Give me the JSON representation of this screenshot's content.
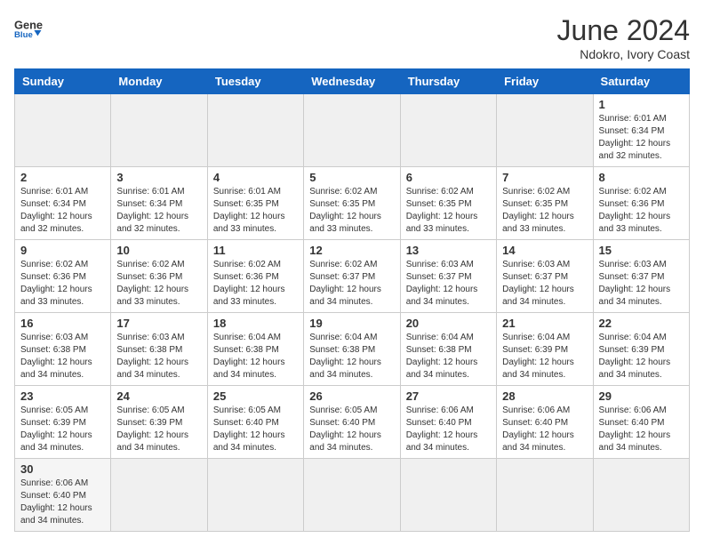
{
  "header": {
    "logo_general": "General",
    "logo_blue": "Blue",
    "month_title": "June 2024",
    "location": "Ndokro, Ivory Coast"
  },
  "weekdays": [
    "Sunday",
    "Monday",
    "Tuesday",
    "Wednesday",
    "Thursday",
    "Friday",
    "Saturday"
  ],
  "weeks": [
    [
      {
        "day": "",
        "empty": true
      },
      {
        "day": "",
        "empty": true
      },
      {
        "day": "",
        "empty": true
      },
      {
        "day": "",
        "empty": true
      },
      {
        "day": "",
        "empty": true
      },
      {
        "day": "",
        "empty": true
      },
      {
        "day": "1",
        "sunrise": "6:01 AM",
        "sunset": "6:34 PM",
        "daylight": "12 hours and 32 minutes."
      }
    ],
    [
      {
        "day": "2",
        "sunrise": "6:01 AM",
        "sunset": "6:34 PM",
        "daylight": "12 hours and 32 minutes."
      },
      {
        "day": "3",
        "sunrise": "6:01 AM",
        "sunset": "6:34 PM",
        "daylight": "12 hours and 32 minutes."
      },
      {
        "day": "4",
        "sunrise": "6:01 AM",
        "sunset": "6:35 PM",
        "daylight": "12 hours and 33 minutes."
      },
      {
        "day": "5",
        "sunrise": "6:02 AM",
        "sunset": "6:35 PM",
        "daylight": "12 hours and 33 minutes."
      },
      {
        "day": "6",
        "sunrise": "6:02 AM",
        "sunset": "6:35 PM",
        "daylight": "12 hours and 33 minutes."
      },
      {
        "day": "7",
        "sunrise": "6:02 AM",
        "sunset": "6:35 PM",
        "daylight": "12 hours and 33 minutes."
      },
      {
        "day": "8",
        "sunrise": "6:02 AM",
        "sunset": "6:36 PM",
        "daylight": "12 hours and 33 minutes."
      }
    ],
    [
      {
        "day": "9",
        "sunrise": "6:02 AM",
        "sunset": "6:36 PM",
        "daylight": "12 hours and 33 minutes."
      },
      {
        "day": "10",
        "sunrise": "6:02 AM",
        "sunset": "6:36 PM",
        "daylight": "12 hours and 33 minutes."
      },
      {
        "day": "11",
        "sunrise": "6:02 AM",
        "sunset": "6:36 PM",
        "daylight": "12 hours and 33 minutes."
      },
      {
        "day": "12",
        "sunrise": "6:02 AM",
        "sunset": "6:37 PM",
        "daylight": "12 hours and 34 minutes."
      },
      {
        "day": "13",
        "sunrise": "6:03 AM",
        "sunset": "6:37 PM",
        "daylight": "12 hours and 34 minutes."
      },
      {
        "day": "14",
        "sunrise": "6:03 AM",
        "sunset": "6:37 PM",
        "daylight": "12 hours and 34 minutes."
      },
      {
        "day": "15",
        "sunrise": "6:03 AM",
        "sunset": "6:37 PM",
        "daylight": "12 hours and 34 minutes."
      }
    ],
    [
      {
        "day": "16",
        "sunrise": "6:03 AM",
        "sunset": "6:38 PM",
        "daylight": "12 hours and 34 minutes."
      },
      {
        "day": "17",
        "sunrise": "6:03 AM",
        "sunset": "6:38 PM",
        "daylight": "12 hours and 34 minutes."
      },
      {
        "day": "18",
        "sunrise": "6:04 AM",
        "sunset": "6:38 PM",
        "daylight": "12 hours and 34 minutes."
      },
      {
        "day": "19",
        "sunrise": "6:04 AM",
        "sunset": "6:38 PM",
        "daylight": "12 hours and 34 minutes."
      },
      {
        "day": "20",
        "sunrise": "6:04 AM",
        "sunset": "6:38 PM",
        "daylight": "12 hours and 34 minutes."
      },
      {
        "day": "21",
        "sunrise": "6:04 AM",
        "sunset": "6:39 PM",
        "daylight": "12 hours and 34 minutes."
      },
      {
        "day": "22",
        "sunrise": "6:04 AM",
        "sunset": "6:39 PM",
        "daylight": "12 hours and 34 minutes."
      }
    ],
    [
      {
        "day": "23",
        "sunrise": "6:05 AM",
        "sunset": "6:39 PM",
        "daylight": "12 hours and 34 minutes."
      },
      {
        "day": "24",
        "sunrise": "6:05 AM",
        "sunset": "6:39 PM",
        "daylight": "12 hours and 34 minutes."
      },
      {
        "day": "25",
        "sunrise": "6:05 AM",
        "sunset": "6:40 PM",
        "daylight": "12 hours and 34 minutes."
      },
      {
        "day": "26",
        "sunrise": "6:05 AM",
        "sunset": "6:40 PM",
        "daylight": "12 hours and 34 minutes."
      },
      {
        "day": "27",
        "sunrise": "6:06 AM",
        "sunset": "6:40 PM",
        "daylight": "12 hours and 34 minutes."
      },
      {
        "day": "28",
        "sunrise": "6:06 AM",
        "sunset": "6:40 PM",
        "daylight": "12 hours and 34 minutes."
      },
      {
        "day": "29",
        "sunrise": "6:06 AM",
        "sunset": "6:40 PM",
        "daylight": "12 hours and 34 minutes."
      }
    ],
    [
      {
        "day": "30",
        "sunrise": "6:06 AM",
        "sunset": "6:40 PM",
        "daylight": "12 hours and 34 minutes."
      },
      {
        "day": "",
        "empty": true
      },
      {
        "day": "",
        "empty": true
      },
      {
        "day": "",
        "empty": true
      },
      {
        "day": "",
        "empty": true
      },
      {
        "day": "",
        "empty": true
      },
      {
        "day": "",
        "empty": true
      }
    ]
  ]
}
